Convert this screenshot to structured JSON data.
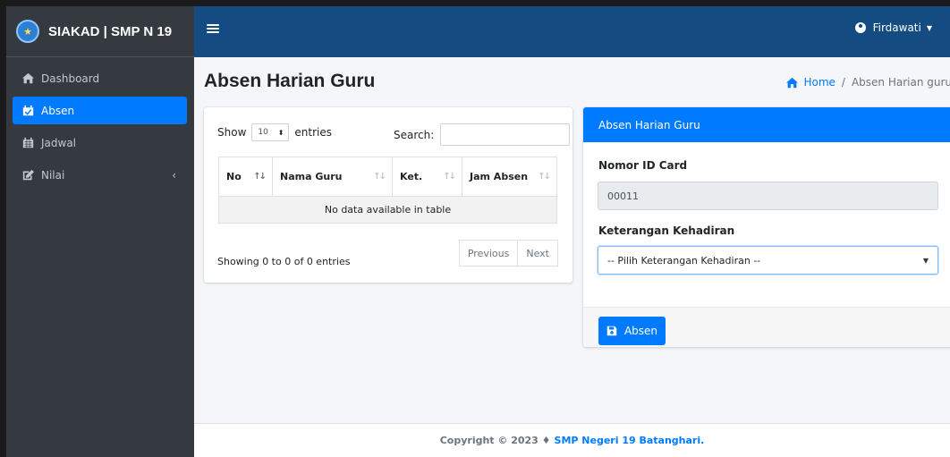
{
  "app": {
    "brand_logo_text": "★",
    "brand_title": "SIAKAD | SMP N 19"
  },
  "sidebar": {
    "items": [
      {
        "label": "Dashboard",
        "icon": "home-icon",
        "active": false
      },
      {
        "label": "Absen",
        "icon": "calendar-check-icon",
        "active": true
      },
      {
        "label": "Jadwal",
        "icon": "calendar-icon",
        "active": false
      },
      {
        "label": "Nilai",
        "icon": "edit-icon",
        "active": false,
        "has_submenu": true
      }
    ],
    "submenu_chevron": "‹"
  },
  "topbar": {
    "menu_icon": "hamburger-icon",
    "user_name": "Firdawati",
    "user_caret": "▼"
  },
  "page": {
    "title": "Absen Harian Guru"
  },
  "breadcrumb": {
    "home": "Home",
    "separator": "/",
    "current": "Absen Harian guru"
  },
  "datatable": {
    "show_label": "Show",
    "entries_value": "10",
    "entries_label": "entries",
    "search_label": "Search:",
    "columns": [
      "No",
      "Nama Guru",
      "Ket.",
      "Jam Absen"
    ],
    "empty_message": "No data available in table",
    "info": "Showing 0 to 0 of 0 entries",
    "prev_label": "Previous",
    "next_label": "Next"
  },
  "form": {
    "header": "Absen Harian Guru",
    "id_card_label": "Nomor ID Card",
    "id_card_value": "00011",
    "kehadiran_label": "Keterangan Kehadiran",
    "kehadiran_selected": "-- Pilih Keterangan Kehadiran --",
    "submit_label": "Absen"
  },
  "footer": {
    "copyright": "Copyright © 2023 ♦",
    "school": "SMP Negeri 19 Batanghari."
  },
  "colors": {
    "sidebar_bg": "#343a40",
    "topbar_bg": "#144c82",
    "accent": "#007bff"
  }
}
